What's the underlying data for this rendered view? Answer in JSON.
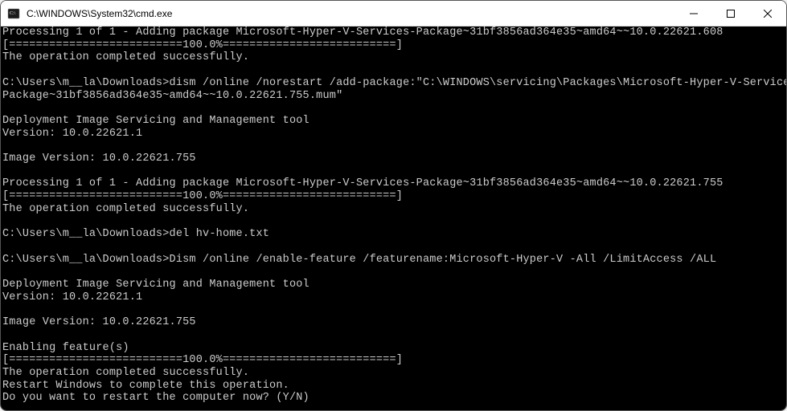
{
  "window": {
    "title": "C:\\WINDOWS\\System32\\cmd.exe"
  },
  "terminal": {
    "lines": [
      "Processing 1 of 1 - Adding package Microsoft-Hyper-V-Services-Package~31bf3856ad364e35~amd64~~10.0.22621.608",
      "[==========================100.0%==========================]",
      "The operation completed successfully.",
      "",
      "C:\\Users\\m__la\\Downloads>dism /online /norestart /add-package:\"C:\\WINDOWS\\servicing\\Packages\\Microsoft-Hyper-V-Services-",
      "Package~31bf3856ad364e35~amd64~~10.0.22621.755.mum\"",
      "",
      "Deployment Image Servicing and Management tool",
      "Version: 10.0.22621.1",
      "",
      "Image Version: 10.0.22621.755",
      "",
      "Processing 1 of 1 - Adding package Microsoft-Hyper-V-Services-Package~31bf3856ad364e35~amd64~~10.0.22621.755",
      "[==========================100.0%==========================]",
      "The operation completed successfully.",
      "",
      "C:\\Users\\m__la\\Downloads>del hv-home.txt",
      "",
      "C:\\Users\\m__la\\Downloads>Dism /online /enable-feature /featurename:Microsoft-Hyper-V -All /LimitAccess /ALL",
      "",
      "Deployment Image Servicing and Management tool",
      "Version: 10.0.22621.1",
      "",
      "Image Version: 10.0.22621.755",
      "",
      "Enabling feature(s)",
      "[==========================100.0%==========================]",
      "The operation completed successfully.",
      "Restart Windows to complete this operation.",
      "Do you want to restart the computer now? (Y/N)"
    ]
  }
}
